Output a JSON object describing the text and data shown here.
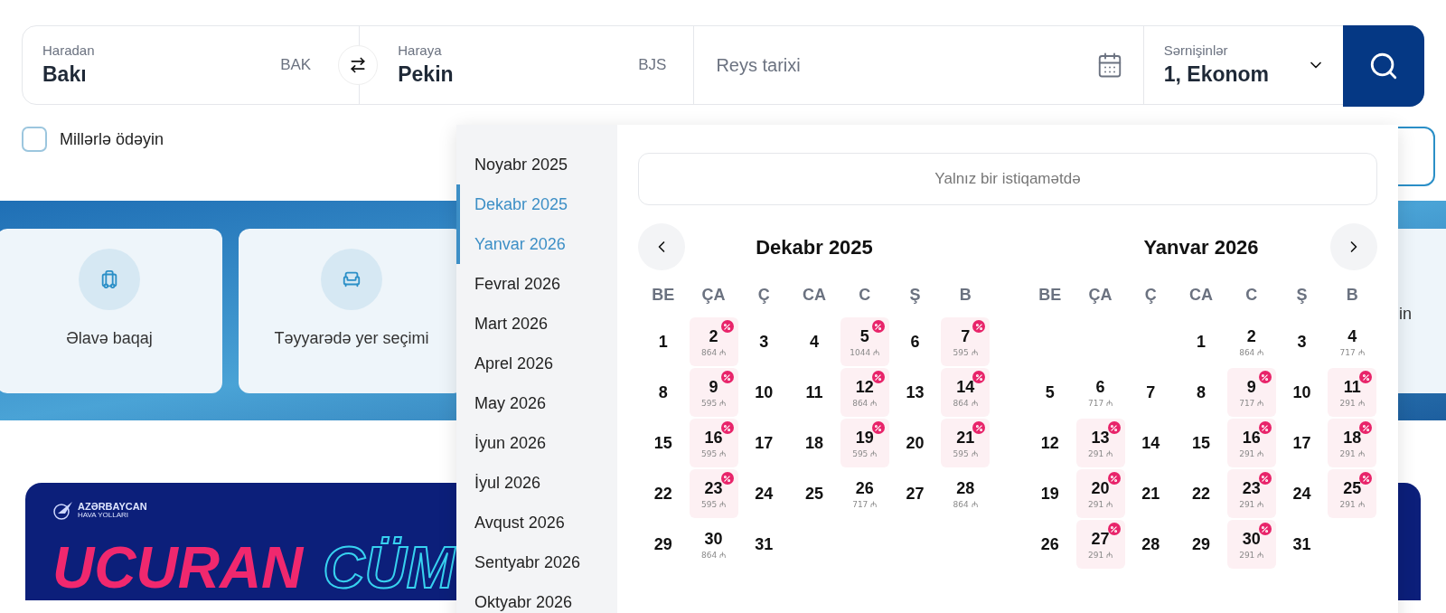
{
  "search": {
    "from": {
      "label": "Haradan",
      "value": "Bakı",
      "code": "BAK"
    },
    "to": {
      "label": "Haraya",
      "value": "Pekin",
      "code": "BJS"
    },
    "date": {
      "placeholder": "Reys tarixi"
    },
    "passengers": {
      "label": "Sərnişinlər",
      "value": "1, Ekonom"
    }
  },
  "miles": {
    "label": "Millərlə ödəyin",
    "checked": false
  },
  "services": [
    {
      "label": "Əlavə baqaj",
      "kind": "baggage"
    },
    {
      "label": "Təyyarədə yer seçimi",
      "kind": "seat"
    }
  ],
  "service_cut": {
    "label": "in"
  },
  "banner": {
    "logo_name": "AZƏRBAYCAN",
    "logo_sub": "HAVA YOLLARI",
    "headline": "UCURAN",
    "headline_outline": "CÜM"
  },
  "picker": {
    "months": [
      {
        "label": "Noyabr 2025",
        "selected": false
      },
      {
        "label": "Dekabr 2025",
        "selected": true
      },
      {
        "label": "Yanvar 2026",
        "selected": true
      },
      {
        "label": "Fevral 2026",
        "selected": false
      },
      {
        "label": "Mart 2026",
        "selected": false
      },
      {
        "label": "Aprel 2026",
        "selected": false
      },
      {
        "label": "May 2026",
        "selected": false
      },
      {
        "label": "İyun 2026",
        "selected": false
      },
      {
        "label": "İyul 2026",
        "selected": false
      },
      {
        "label": "Avqust 2026",
        "selected": false
      },
      {
        "label": "Sentyabr 2026",
        "selected": false
      },
      {
        "label": "Oktyabr 2026",
        "selected": false
      }
    ],
    "one_way": "Yalnız bir istiqamətdə",
    "calendars": [
      {
        "title": "Dekabr 2025",
        "prev_button": true,
        "next_button": false,
        "weekdays": [
          "BE",
          "ÇA",
          "Ç",
          "CA",
          "C",
          "Ş",
          "B"
        ],
        "weeks": [
          [
            {
              "day": "1"
            },
            {
              "day": "2",
              "price": "864 ₼",
              "discount": true
            },
            {
              "day": "3"
            },
            {
              "day": "4"
            },
            {
              "day": "5",
              "price": "1044 ₼",
              "discount": true
            },
            {
              "day": "6"
            },
            {
              "day": "7",
              "price": "595 ₼",
              "discount": true
            }
          ],
          [
            {
              "day": "8"
            },
            {
              "day": "9",
              "price": "595 ₼",
              "discount": true
            },
            {
              "day": "10"
            },
            {
              "day": "11"
            },
            {
              "day": "12",
              "price": "864 ₼",
              "discount": true
            },
            {
              "day": "13"
            },
            {
              "day": "14",
              "price": "864 ₼",
              "discount": true
            }
          ],
          [
            {
              "day": "15"
            },
            {
              "day": "16",
              "price": "595 ₼",
              "discount": true
            },
            {
              "day": "17"
            },
            {
              "day": "18"
            },
            {
              "day": "19",
              "price": "595 ₼",
              "discount": true
            },
            {
              "day": "20"
            },
            {
              "day": "21",
              "price": "595 ₼",
              "discount": true
            }
          ],
          [
            {
              "day": "22"
            },
            {
              "day": "23",
              "price": "595 ₼",
              "discount": true
            },
            {
              "day": "24"
            },
            {
              "day": "25"
            },
            {
              "day": "26",
              "price": "717 ₼",
              "discount": false
            },
            {
              "day": "27"
            },
            {
              "day": "28",
              "price": "864 ₼",
              "discount": false
            }
          ],
          [
            {
              "day": "29"
            },
            {
              "day": "30",
              "price": "864 ₼",
              "discount": false
            },
            {
              "day": "31"
            }
          ]
        ]
      },
      {
        "title": "Yanvar 2026",
        "prev_button": false,
        "next_button": true,
        "weekdays": [
          "BE",
          "ÇA",
          "Ç",
          "CA",
          "C",
          "Ş",
          "B"
        ],
        "weeks": [
          [
            {
              "day": "1"
            },
            {
              "day": "2",
              "price": "864 ₼",
              "discount": false
            },
            {
              "day": "3"
            },
            {
              "day": "4",
              "price": "717 ₼",
              "discount": false
            }
          ],
          [
            {
              "day": "5"
            },
            {
              "day": "6",
              "price": "717 ₼",
              "discount": false
            },
            {
              "day": "7"
            },
            {
              "day": "8"
            },
            {
              "day": "9",
              "price": "717 ₼",
              "discount": true
            },
            {
              "day": "10"
            },
            {
              "day": "11",
              "price": "291 ₼",
              "discount": true
            }
          ],
          [
            {
              "day": "12"
            },
            {
              "day": "13",
              "price": "291 ₼",
              "discount": true
            },
            {
              "day": "14"
            },
            {
              "day": "15"
            },
            {
              "day": "16",
              "price": "291 ₼",
              "discount": true
            },
            {
              "day": "17"
            },
            {
              "day": "18",
              "price": "291 ₼",
              "discount": true
            }
          ],
          [
            {
              "day": "19"
            },
            {
              "day": "20",
              "price": "291 ₼",
              "discount": true
            },
            {
              "day": "21"
            },
            {
              "day": "22"
            },
            {
              "day": "23",
              "price": "291 ₼",
              "discount": true
            },
            {
              "day": "24"
            },
            {
              "day": "25",
              "price": "291 ₼",
              "discount": true
            }
          ],
          [
            {
              "day": "26"
            },
            {
              "day": "27",
              "price": "291 ₼",
              "discount": true
            },
            {
              "day": "28"
            },
            {
              "day": "29"
            },
            {
              "day": "30",
              "price": "291 ₼",
              "discount": true
            },
            {
              "day": "31"
            }
          ]
        ]
      }
    ]
  }
}
